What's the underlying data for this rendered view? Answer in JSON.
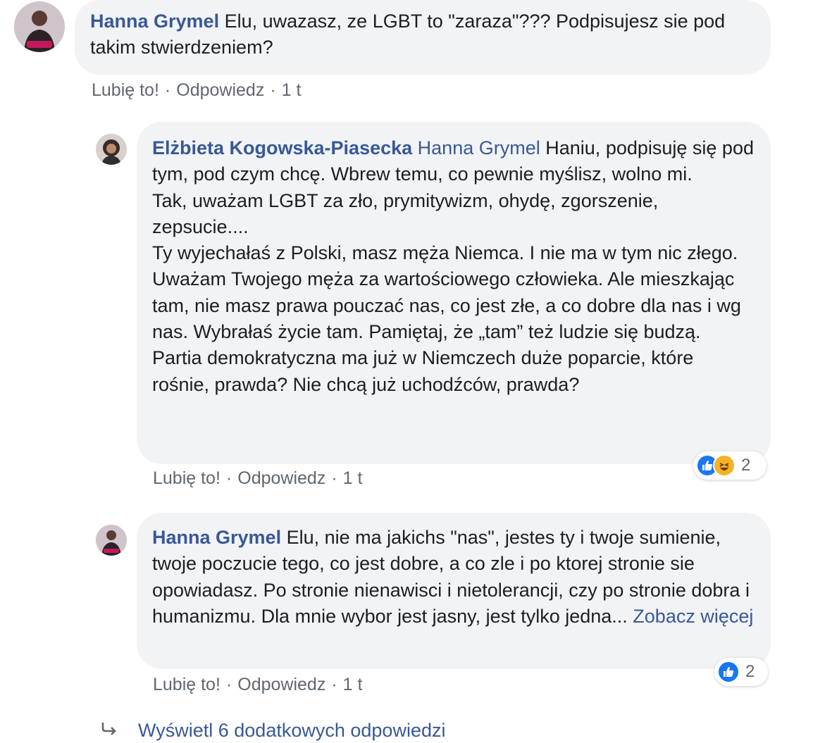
{
  "comments": [
    {
      "author": "Hanna Grymel",
      "mention": "",
      "text": "Elu, uwazasz, ze LGBT to \"zaraza\"??? Podpisujesz sie pod takim stwierdzeniem?",
      "like_label": "Lubię to!",
      "reply_label": "Odpowiedz",
      "time": "1 t"
    },
    {
      "author": "Elżbieta Kogowska-Piasecka",
      "mention": "Hanna Grymel",
      "text": "Haniu, podpisuję się pod tym, pod czym chcę. Wbrew temu, co pewnie myślisz, wolno mi.\nTak, uważam LGBT za zło, prymitywizm, ohydę, zgorszenie, zepsucie....\nTy wyjechałaś z Polski, masz męża Niemca. I nie ma w tym nic złego. Uważam Twojego męża za wartościowego człowieka. Ale mieszkając tam, nie masz prawa pouczać nas, co jest złe, a co dobre dla nas i wg nas. Wybrałaś życie tam. Pamiętaj, że „tam” też ludzie się budzą.\nPartia demokratyczna ma już w Niemczech duże poparcie, które rośnie, prawda? Nie chcą już uchodźców, prawda?",
      "like_label": "Lubię to!",
      "reply_label": "Odpowiedz",
      "time": "1 t",
      "reactions": {
        "count": "2",
        "types": [
          "like-icon",
          "haha-icon"
        ]
      }
    },
    {
      "author": "Hanna Grymel",
      "mention": "",
      "text": "Elu, nie ma jakichs \"nas\", jestes ty i twoje sumienie, twoje poczucie tego, co jest dobre, a co zle i po ktorej stronie sie opowiadasz. Po stronie nienawisci i nietolerancji, czy po stronie dobra i humanizmu. Dla mnie wybor jest jasny, jest tylko jedna...",
      "see_more": "Zobacz więcej",
      "like_label": "Lubię to!",
      "reply_label": "Odpowiedz",
      "time": "1 t",
      "reactions": {
        "count": "2",
        "types": [
          "like-icon"
        ]
      }
    }
  ],
  "more_replies": {
    "icon": "reply-arrow-icon",
    "label": "Wyświetl 6 dodatkowych odpowiedzi"
  },
  "colors": {
    "author_link": "#385898",
    "bubble_bg": "#f2f3f5",
    "meta_text": "#606770",
    "like_blue": "#1877f2",
    "haha_yellow": "#f7b125"
  }
}
